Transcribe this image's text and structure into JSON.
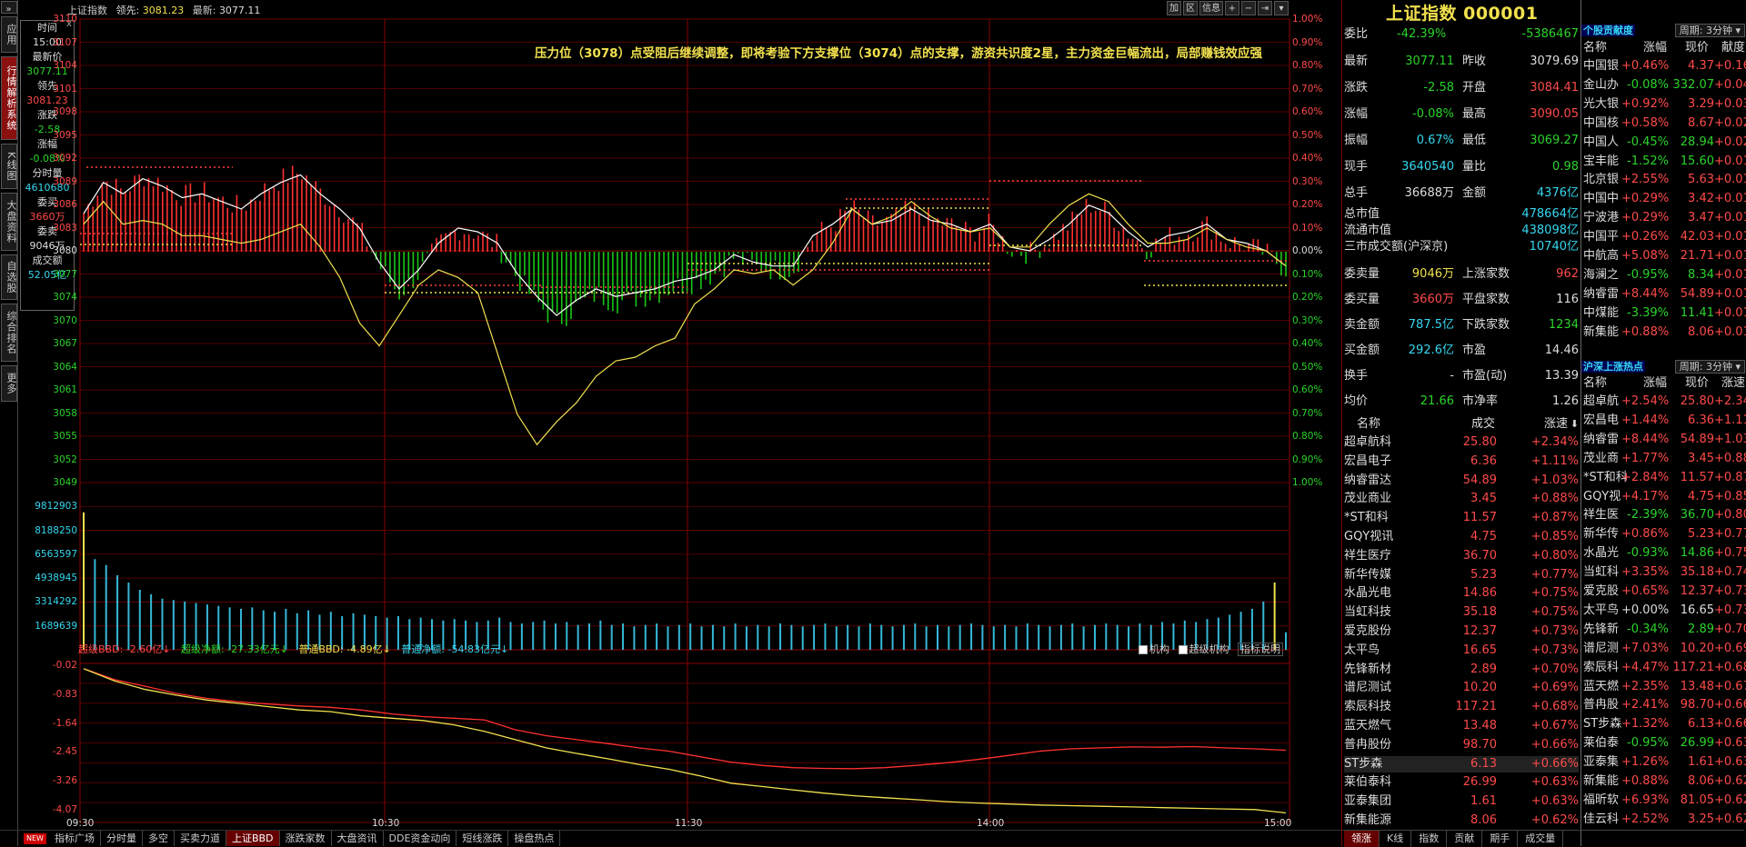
{
  "window": {
    "name": "上证指数",
    "lead_label": "领先:",
    "lead_val": "3081.23",
    "latest_label": "最新:",
    "latest_val": "3077.11"
  },
  "toolbar": {
    "add": "加",
    "zone": "区",
    "info": "信息",
    "plus": "+",
    "minus": "−",
    "end": "⇥",
    "menu": "▾"
  },
  "left_tabs": [
    {
      "label": "应用",
      "active": false
    },
    {
      "label": "行情解析系统",
      "active": true
    },
    {
      "label": "K线图",
      "active": false
    },
    {
      "label": "大盘资料",
      "active": false
    },
    {
      "label": "自选股",
      "active": false
    },
    {
      "label": "综合排名",
      "active": false
    },
    {
      "label": "更多",
      "active": false
    }
  ],
  "cursor_panel": [
    {
      "label": "时间",
      "value": "15:00",
      "c": "#ddd"
    },
    {
      "label": "最新价",
      "value": "3077.11",
      "c": "#2bd42b"
    },
    {
      "label": "领先",
      "value": "3081.23",
      "c": "#ff4a4a"
    },
    {
      "label": "涨跌",
      "value": "-2.58",
      "c": "#2bd42b"
    },
    {
      "label": "涨幅",
      "value": "-0.08%",
      "c": "#2bd42b"
    },
    {
      "label": "分时量",
      "value": "4610680",
      "c": "#35d7f0"
    },
    {
      "label": "委买",
      "value": "3660万",
      "c": "#ff4a4a"
    },
    {
      "label": "委卖",
      "value": "9046万",
      "c": "#ddd"
    },
    {
      "label": "成交额",
      "value": "52.05亿",
      "c": "#35d7f0"
    }
  ],
  "close_mark": "x",
  "annotation": "压力位（3078）点受阻后继续调整，即将考验下方支撑位（3074）点的支撑，游资共识度2星，主力资金巨幅流出，局部赚钱效应强",
  "price_axis_left": [
    "3110",
    "3107",
    "3104",
    "3101",
    "3098",
    "3095",
    "3092",
    "3089",
    "3086",
    "3083",
    "3080",
    "3077",
    "3074",
    "3070",
    "3067",
    "3064",
    "3061",
    "3058",
    "3055",
    "3052",
    "3049"
  ],
  "pct_axis_right": [
    "1.00%",
    "0.90%",
    "0.80%",
    "0.70%",
    "0.60%",
    "0.50%",
    "0.40%",
    "0.30%",
    "0.20%",
    "0.10%",
    "0.00%",
    "0.10%",
    "0.20%",
    "0.30%",
    "0.40%",
    "0.50%",
    "0.60%",
    "0.70%",
    "0.80%",
    "0.90%",
    "1.00%"
  ],
  "volume_axis": [
    "9812903",
    "8188250",
    "6563597",
    "4938945",
    "3314292",
    "1689639"
  ],
  "bbd_legend": {
    "a": "超级BBD: -2.60亿↓",
    "b": "超级净额: -27.33亿元↓",
    "c": "普通BBD: -4.89亿↓",
    "d": "普通净额: -54.83亿元↓"
  },
  "bbd_right": {
    "a": "机构",
    "b": "超级机构",
    "c": "指标说明"
  },
  "bbd_axis": [
    "-0.02",
    "-0.83",
    "-1.64",
    "-2.45",
    "-3.26",
    "-4.07"
  ],
  "time_axis": [
    "09:30",
    "10:30",
    "11:30",
    "14:00",
    "15:00"
  ],
  "bottom_tabs": [
    {
      "label": "指标广场",
      "active": false
    },
    {
      "label": "分时量",
      "active": false
    },
    {
      "label": "多空",
      "active": false
    },
    {
      "label": "买卖力道",
      "active": false
    },
    {
      "label": "上证BBD",
      "active": true
    },
    {
      "label": "涨跌家数",
      "active": false
    },
    {
      "label": "大盘资讯",
      "active": false
    },
    {
      "label": "DDE资金动向",
      "active": false
    },
    {
      "label": "短线涨跌",
      "active": false
    },
    {
      "label": "操盘热点",
      "active": false
    }
  ],
  "new_badge": "NEW",
  "quote": {
    "title": "上证指数 000001",
    "webi_label": "委比",
    "webi_pct": "-42.39%",
    "webi_diff": "-5386467",
    "rows": [
      {
        "l1": "最新",
        "v1": "3077.11",
        "c1": "#2bd42b",
        "l2": "昨收",
        "v2": "3079.69",
        "c2": "#ddd"
      },
      {
        "l1": "涨跌",
        "v1": "-2.58",
        "c1": "#2bd42b",
        "l2": "开盘",
        "v2": "3084.41",
        "c2": "#ff4a4a"
      },
      {
        "l1": "涨幅",
        "v1": "-0.08%",
        "c1": "#2bd42b",
        "l2": "最高",
        "v2": "3090.05",
        "c2": "#ff4a4a"
      },
      {
        "l1": "振幅",
        "v1": "0.67%",
        "c1": "#35d7f0",
        "l2": "最低",
        "v2": "3069.27",
        "c2": "#2bd42b"
      },
      {
        "l1": "现手",
        "v1": "3640540",
        "c1": "#35d7f0",
        "l2": "量比",
        "v2": "0.98",
        "c2": "#2bd42b"
      },
      {
        "l1": "总手",
        "v1": "36688万",
        "c1": "#ddd",
        "l2": "金额",
        "v2": "4376亿",
        "c2": "#35d7f0"
      }
    ],
    "mkt": [
      {
        "l": "总市值",
        "v": "478664亿"
      },
      {
        "l": "流通市值",
        "v": "438098亿"
      },
      {
        "l": "三市成交额(沪深京)",
        "v": "10740亿"
      }
    ],
    "rows2": [
      {
        "l1": "委卖量",
        "v1": "9046万",
        "c1": "#f2e14e",
        "l2": "上涨家数",
        "v2": "962",
        "c2": "#ff4a4a"
      },
      {
        "l1": "委买量",
        "v1": "3660万",
        "c1": "#ff4a4a",
        "l2": "平盘家数",
        "v2": "116",
        "c2": "#ddd"
      },
      {
        "l1": "卖金额",
        "v1": "787.5亿",
        "c1": "#35d7f0",
        "l2": "下跌家数",
        "v2": "1234",
        "c2": "#2bd42b"
      },
      {
        "l1": "买金额",
        "v1": "292.6亿",
        "c1": "#35d7f0",
        "l2": "市盈",
        "v2": "14.46",
        "c2": "#ddd"
      },
      {
        "l1": "换手",
        "v1": "-",
        "c1": "#ddd",
        "l2": "市盈(动)",
        "v2": "13.39",
        "c2": "#ddd"
      },
      {
        "l1": "均价",
        "v1": "21.66",
        "c1": "#2bd42b",
        "l2": "市净率",
        "v2": "1.26",
        "c2": "#ddd"
      }
    ]
  },
  "list": {
    "header": {
      "name": "名称",
      "deal": "成交",
      "speed": "涨速"
    },
    "rows": [
      {
        "n": "超卓航科",
        "p": "25.80",
        "s": "+2.34%"
      },
      {
        "n": "宏昌电子",
        "p": "6.36",
        "s": "+1.11%"
      },
      {
        "n": "纳睿雷达",
        "p": "54.89",
        "s": "+1.03%"
      },
      {
        "n": "茂业商业",
        "p": "3.45",
        "s": "+0.88%"
      },
      {
        "n": "*ST和科",
        "p": "11.57",
        "s": "+0.87%"
      },
      {
        "n": "GQY视讯",
        "p": "4.75",
        "s": "+0.85%"
      },
      {
        "n": "祥生医疗",
        "p": "36.70",
        "s": "+0.80%"
      },
      {
        "n": "新华传媒",
        "p": "5.23",
        "s": "+0.77%"
      },
      {
        "n": "水晶光电",
        "p": "14.86",
        "s": "+0.75%"
      },
      {
        "n": "当虹科技",
        "p": "35.18",
        "s": "+0.75%"
      },
      {
        "n": "爱克股份",
        "p": "12.37",
        "s": "+0.73%"
      },
      {
        "n": "太平鸟",
        "p": "16.65",
        "s": "+0.73%"
      },
      {
        "n": "先锋新材",
        "p": "2.89",
        "s": "+0.70%"
      },
      {
        "n": "谱尼测试",
        "p": "10.20",
        "s": "+0.69%"
      },
      {
        "n": "索辰科技",
        "p": "117.21",
        "s": "+0.68%"
      },
      {
        "n": "蓝天燃气",
        "p": "13.48",
        "s": "+0.67%"
      },
      {
        "n": "普冉股份",
        "p": "98.70",
        "s": "+0.66%"
      },
      {
        "n": "ST步森",
        "p": "6.13",
        "s": "+0.66%"
      },
      {
        "n": "莱伯泰科",
        "p": "26.99",
        "s": "+0.63%"
      },
      {
        "n": "亚泰集团",
        "p": "1.61",
        "s": "+0.63%"
      },
      {
        "n": "新集能源",
        "p": "8.06",
        "s": "+0.62%"
      }
    ]
  },
  "right_tabs": [
    {
      "label": "领涨",
      "active": true
    },
    {
      "label": "K线",
      "active": false
    },
    {
      "label": "指数",
      "active": false
    },
    {
      "label": "贡献",
      "active": false
    },
    {
      "label": "期手",
      "active": false
    },
    {
      "label": "成交量",
      "active": false
    }
  ],
  "contrib": {
    "title": "个股贡献度",
    "period": "周期: 3分钟",
    "header": {
      "name": "名称",
      "chg": "涨幅",
      "price": "现价",
      "cont": "献度"
    },
    "rows": [
      {
        "n": "中国银",
        "c": "+0.46%",
        "p": "4.37",
        "d": "+0.16"
      },
      {
        "n": "金山办",
        "c": "-0.08%",
        "p": "332.07",
        "d": "+0.04"
      },
      {
        "n": "光大银",
        "c": "+0.92%",
        "p": "3.29",
        "d": "+0.03"
      },
      {
        "n": "中国核",
        "c": "+0.58%",
        "p": "8.67",
        "d": "+0.02"
      },
      {
        "n": "中国人",
        "c": "-0.45%",
        "p": "28.94",
        "d": "+0.02"
      },
      {
        "n": "宝丰能",
        "c": "-1.52%",
        "p": "15.60",
        "d": "+0.01"
      },
      {
        "n": "北京银",
        "c": "+2.55%",
        "p": "5.63",
        "d": "+0.01"
      },
      {
        "n": "中国中",
        "c": "+0.29%",
        "p": "3.42",
        "d": "+0.01"
      },
      {
        "n": "宁波港",
        "c": "+0.29%",
        "p": "3.47",
        "d": "+0.01"
      },
      {
        "n": "中国平",
        "c": "+0.26%",
        "p": "42.03",
        "d": "+0.01"
      },
      {
        "n": "中航高",
        "c": "+5.08%",
        "p": "21.71",
        "d": "+0.01"
      },
      {
        "n": "海澜之",
        "c": "-0.95%",
        "p": "8.34",
        "d": "+0.01"
      },
      {
        "n": "纳睿雷",
        "c": "+8.44%",
        "p": "54.89",
        "d": "+0.01"
      },
      {
        "n": "中煤能",
        "c": "-3.39%",
        "p": "11.41",
        "d": "+0.01"
      },
      {
        "n": "新集能",
        "c": "+0.88%",
        "p": "8.06",
        "d": "+0.01"
      }
    ]
  },
  "hot": {
    "title": "沪深上涨热点",
    "period": "周期: 3分钟",
    "header": {
      "name": "名称",
      "chg": "涨幅",
      "price": "现价",
      "speed": "涨速"
    },
    "rows": [
      {
        "n": "超卓航",
        "c": "+2.54%",
        "p": "25.80",
        "s": "+2.34%"
      },
      {
        "n": "宏昌电",
        "c": "+1.44%",
        "p": "6.36",
        "s": "+1.11%"
      },
      {
        "n": "纳睿雷",
        "c": "+8.44%",
        "p": "54.89",
        "s": "+1.03%"
      },
      {
        "n": "茂业商",
        "c": "+1.77%",
        "p": "3.45",
        "s": "+0.88%"
      },
      {
        "n": "*ST和科",
        "c": "+2.84%",
        "p": "11.57",
        "s": "+0.87%"
      },
      {
        "n": "GQY视",
        "c": "+4.17%",
        "p": "4.75",
        "s": "+0.85%"
      },
      {
        "n": "祥生医",
        "c": "-2.39%",
        "p": "36.70",
        "s": "+0.80%"
      },
      {
        "n": "新华传",
        "c": "+0.86%",
        "p": "5.23",
        "s": "+0.77%"
      },
      {
        "n": "水晶光",
        "c": "-0.93%",
        "p": "14.86",
        "s": "+0.75%"
      },
      {
        "n": "当虹科",
        "c": "+3.35%",
        "p": "35.18",
        "s": "+0.74%"
      },
      {
        "n": "爱克股",
        "c": "+0.65%",
        "p": "12.37",
        "s": "+0.73%"
      },
      {
        "n": "太平鸟",
        "c": "+0.00%",
        "p": "16.65",
        "s": "+0.73%"
      },
      {
        "n": "先锋新",
        "c": "-0.34%",
        "p": "2.89",
        "s": "+0.70%"
      },
      {
        "n": "谱尼测",
        "c": "+7.03%",
        "p": "10.20",
        "s": "+0.69%"
      },
      {
        "n": "索辰科",
        "c": "+4.47%",
        "p": "117.21",
        "s": "+0.68%"
      },
      {
        "n": "蓝天燃",
        "c": "+2.35%",
        "p": "13.48",
        "s": "+0.67%"
      },
      {
        "n": "普冉股",
        "c": "+2.41%",
        "p": "98.70",
        "s": "+0.66%"
      },
      {
        "n": "ST步森",
        "c": "+1.32%",
        "p": "6.13",
        "s": "+0.66%"
      },
      {
        "n": "莱伯泰",
        "c": "-0.95%",
        "p": "26.99",
        "s": "+0.63%"
      },
      {
        "n": "亚泰集",
        "c": "+1.26%",
        "p": "1.61",
        "s": "+0.63%"
      },
      {
        "n": "新集能",
        "c": "+0.88%",
        "p": "8.06",
        "s": "+0.62%"
      },
      {
        "n": "福昕软",
        "c": "+6.93%",
        "p": "81.05",
        "s": "+0.62%"
      },
      {
        "n": "佳云科",
        "c": "+2.52%",
        "p": "3.25",
        "s": "+0.62%"
      }
    ]
  },
  "chart_data": [
    {
      "type": "line",
      "title": "上证指数 分时",
      "x_labels": [
        "09:30",
        "10:30",
        "11:30",
        "14:00",
        "15:00"
      ],
      "ylim": [
        3049,
        3110
      ],
      "prev_close": 3079.69,
      "series": [
        {
          "name": "最新",
          "color": "#ffffff",
          "values": [
            3084.4,
            3088.5,
            3087,
            3089,
            3088,
            3086.5,
            3087,
            3086,
            3085,
            3087,
            3088.5,
            3089.5,
            3087,
            3085,
            3082.5,
            3078,
            3074.5,
            3077,
            3080.5,
            3082.5,
            3082,
            3080.5,
            3076.5,
            3073.5,
            3071,
            3073,
            3074.5,
            3073.5,
            3074,
            3074.5,
            3075.5,
            3076,
            3077,
            3079,
            3078,
            3077.5,
            3077.5,
            3081.5,
            3083,
            3085,
            3083,
            3083.5,
            3085,
            3083.5,
            3083,
            3082,
            3083,
            3080,
            3079.5,
            3081,
            3083,
            3085.5,
            3084.5,
            3082,
            3080,
            3081.5,
            3082,
            3083,
            3081,
            3080.5,
            3079.5,
            3077.5
          ]
        },
        {
          "name": "领先",
          "color": "#f2e14e",
          "values": [
            3083,
            3086,
            3083,
            3083.5,
            3083,
            3081.5,
            3081.5,
            3081,
            3080.5,
            3081,
            3082,
            3083,
            3080,
            3076,
            3070,
            3067,
            3071,
            3075,
            3077,
            3076,
            3074,
            3066,
            3058,
            3054,
            3057,
            3059.5,
            3063,
            3065,
            3065.5,
            3067,
            3068,
            3072.5,
            3074.5,
            3077,
            3076.5,
            3077,
            3075,
            3077,
            3080.5,
            3085,
            3083,
            3084,
            3086,
            3084,
            3082.5,
            3082,
            3082.5,
            3080,
            3080,
            3083,
            3085.5,
            3087,
            3086,
            3083,
            3080.5,
            3080.5,
            3081,
            3082.5,
            3081,
            3080,
            3079.5,
            3077.5
          ]
        }
      ]
    },
    {
      "type": "bar",
      "title": "分时量",
      "ylim": [
        0,
        11437556
      ],
      "values": [
        9400000,
        6200000,
        5800000,
        5100000,
        4600000,
        4100000,
        3800000,
        3500000,
        3400000,
        3300000,
        3200000,
        3100000,
        3000000,
        2900000,
        2800000,
        2900000,
        2700000,
        2600000,
        2800000,
        2500000,
        2700000,
        2400000,
        2600000,
        2300000,
        2500000,
        2400000,
        2300000,
        2200000,
        2300000,
        2100000,
        2200000,
        2100000,
        2000000,
        2100000,
        2000000,
        1900000,
        2000000,
        2200000,
        1900000,
        1800000,
        1900000,
        2000000,
        1800000,
        1900000,
        1700000,
        1800000,
        2000000,
        1700000,
        1800000,
        1600000,
        1700000,
        1800000,
        1600000,
        1700000,
        1800000,
        1600000,
        1700000,
        1600000,
        1800000,
        1600000,
        1700000,
        1600000,
        1800000,
        1700000,
        1600000,
        1700000,
        1800000,
        1600000,
        1700000,
        1600000,
        1800000,
        1700000,
        1600000,
        1700000,
        1800000,
        1600000,
        1700000,
        1600000,
        1700000,
        1800000,
        1700000,
        1600000,
        1700000,
        1600000,
        1800000,
        1700000,
        1600000,
        1700000,
        1800000,
        1600000,
        1700000,
        1800000,
        1700000,
        1600000,
        1800000,
        1700000,
        1900000,
        1800000,
        2000000,
        1900000,
        2100000,
        2200000,
        2400000,
        2600000,
        2800000,
        3300000,
        4600000,
        1200000
      ]
    },
    {
      "type": "line",
      "title": "上证BBD",
      "ylim": [
        -4.6,
        0
      ],
      "series": [
        {
          "name": "超级BBD",
          "color": "#ff3030",
          "values": [
            -0.05,
            -0.38,
            -0.58,
            -0.8,
            -0.95,
            -1.05,
            -1.12,
            -1.18,
            -1.22,
            -1.3,
            -1.42,
            -1.5,
            -1.55,
            -1.6,
            -1.9,
            -2.08,
            -2.2,
            -2.32,
            -2.45,
            -2.55,
            -2.72,
            -2.88,
            -2.98,
            -3.05,
            -3.07,
            -3.08,
            -3.05,
            -2.98,
            -2.9,
            -2.8,
            -2.68,
            -2.55,
            -2.48,
            -2.45,
            -2.42,
            -2.43,
            -2.41,
            -2.45,
            -2.48,
            -2.52
          ]
        },
        {
          "name": "普通BBD",
          "color": "#f2e14e",
          "values": [
            -0.05,
            -0.42,
            -0.68,
            -0.85,
            -1,
            -1.1,
            -1.2,
            -1.3,
            -1.35,
            -1.48,
            -1.55,
            -1.62,
            -1.75,
            -1.95,
            -2.2,
            -2.45,
            -2.62,
            -2.78,
            -2.95,
            -3.1,
            -3.3,
            -3.52,
            -3.62,
            -3.72,
            -3.82,
            -3.9,
            -3.96,
            -4.02,
            -4.08,
            -4.12,
            -4.15,
            -4.18,
            -4.2,
            -4.22,
            -4.24,
            -4.26,
            -4.28,
            -4.3,
            -4.32,
            -4.42
          ]
        }
      ]
    }
  ]
}
